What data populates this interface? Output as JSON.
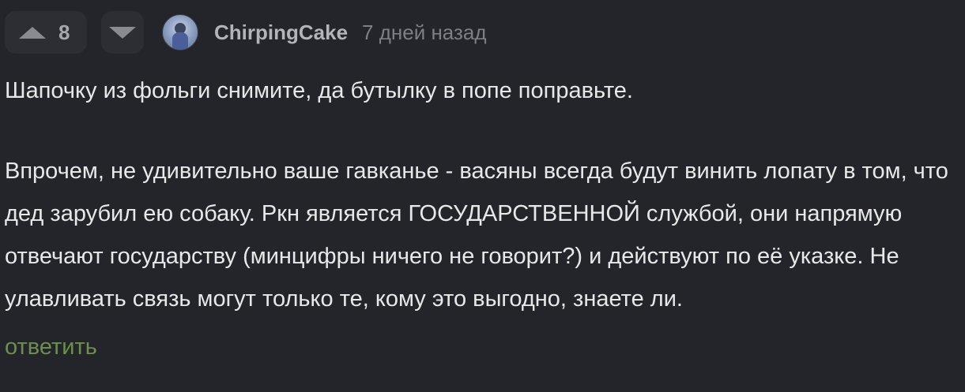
{
  "comment": {
    "vote_count": "8",
    "username": "ChirpingCake",
    "timestamp": "7 дней назад",
    "paragraphs": [
      "Шапочку из фольги снимите, да бутылку в попе поправьте.",
      "Впрочем, не удивительно ваше гавканье - васяны всегда будут винить лопату в том, что дед зарубил ею собаку. Ркн является ГОСУДАРСТВЕННОЙ службой, они напрямую отвечают государству (минцифры ничего не говорит?) и действуют по её указке. Не улавливать связь могут только те, кому это выгодно, знаете ли."
    ],
    "reply_label": "ответить"
  },
  "icons": {
    "upvote": "arrow-up-icon",
    "downvote": "arrow-down-icon"
  },
  "colors": {
    "background": "#24252a",
    "vote_bg": "#2d2e33",
    "reply_link": "#6b8f4e"
  }
}
